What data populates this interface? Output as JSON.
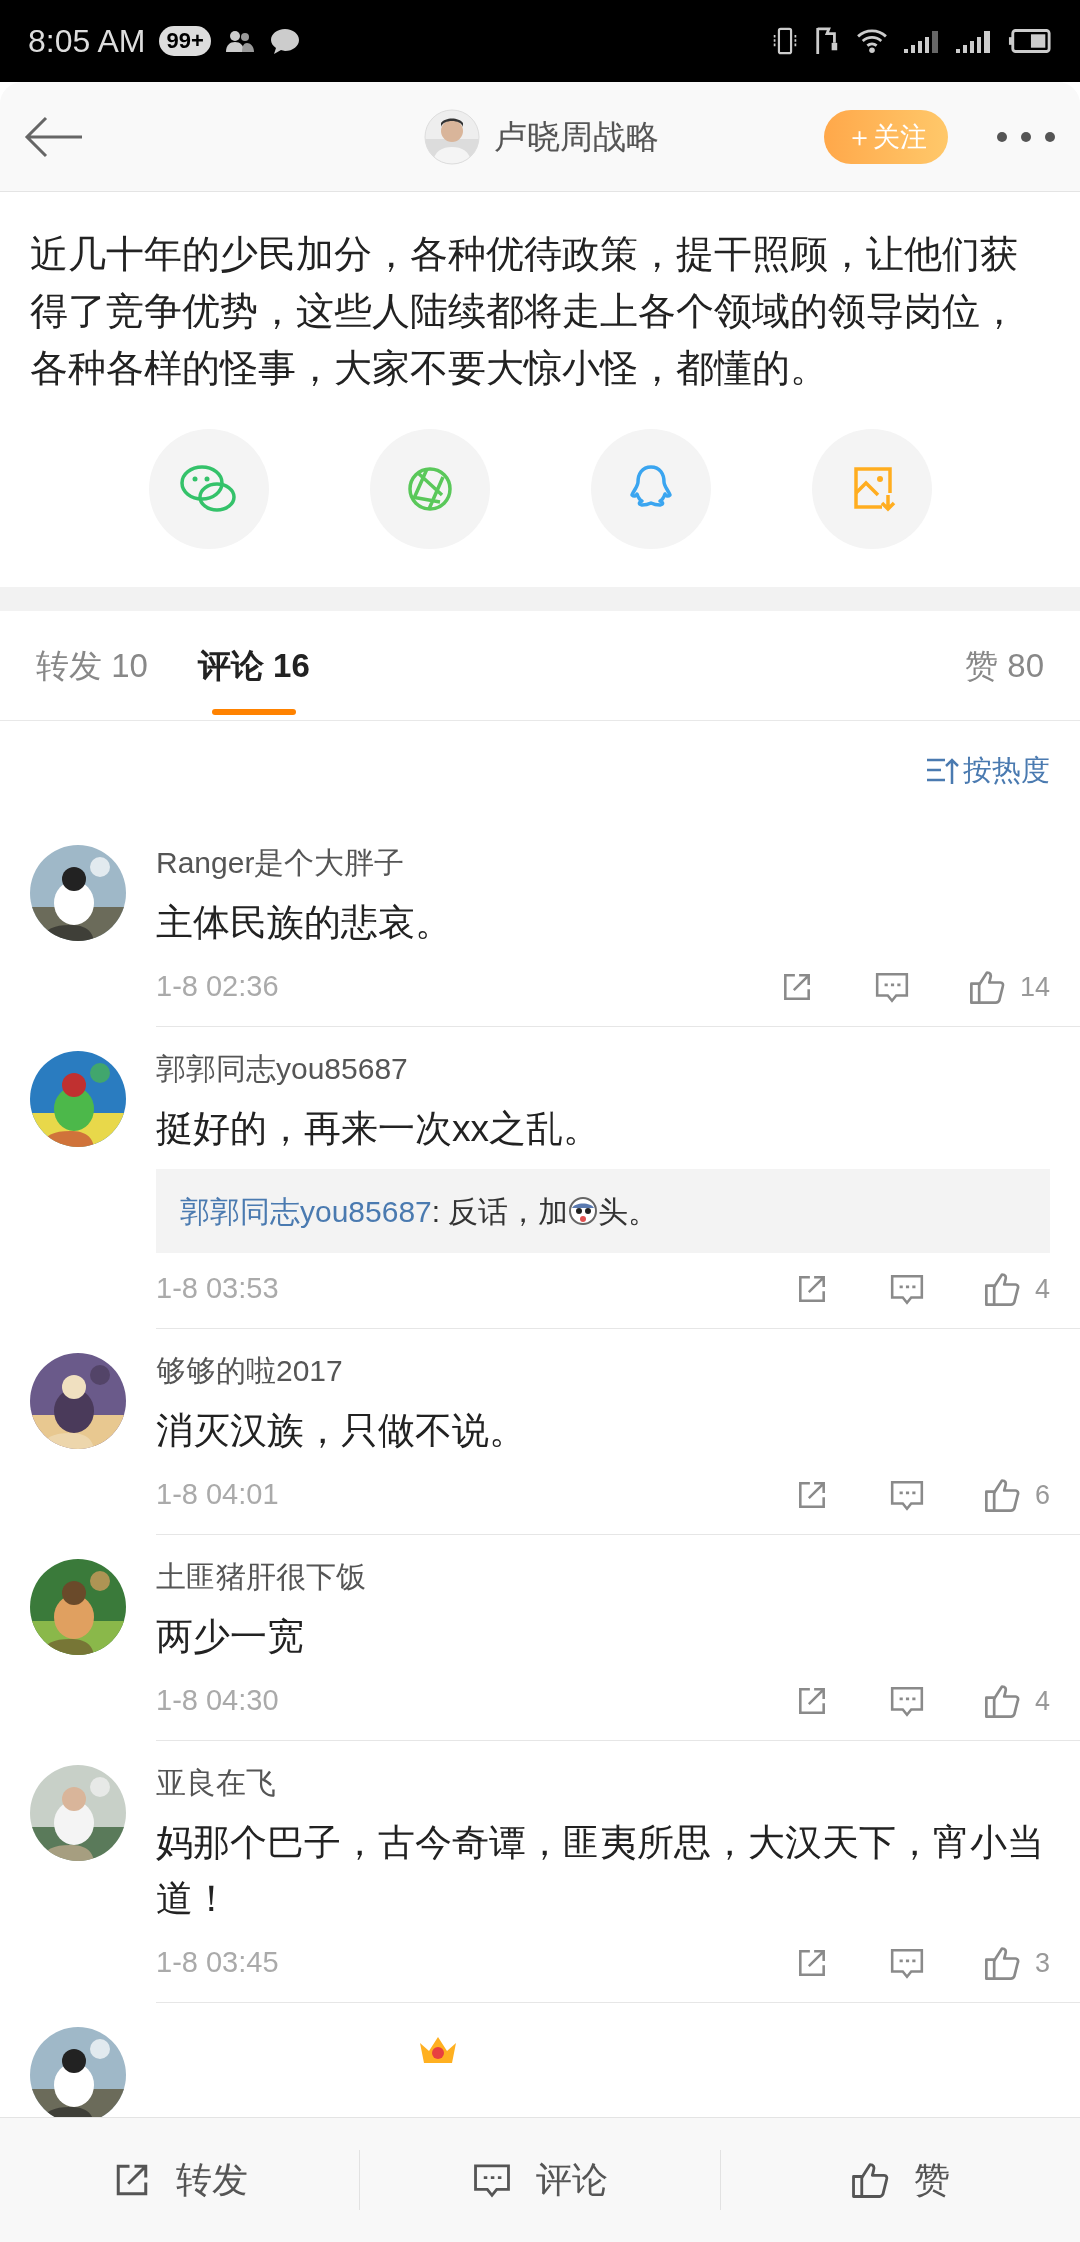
{
  "status_bar": {
    "time": "8:05 AM",
    "badge": "99+"
  },
  "header": {
    "title": "卢晓周战略",
    "follow_button": "＋关注"
  },
  "post": {
    "text": "近几十年的少民加分，各种优待政策，提干照顾，让他们获得了竞争优势，这些人陆续都将走上各个领域的领导岗位，各种各样的怪事，大家不要大惊小怪，都懂的。"
  },
  "tabs": [
    {
      "label": "转发",
      "count": "10",
      "selected": false
    },
    {
      "label": "评论",
      "count": "16",
      "selected": true
    },
    {
      "label": "赞",
      "count": "80",
      "selected": false
    }
  ],
  "sort": {
    "label": "按热度"
  },
  "comments": [
    {
      "name": "Ranger是个大胖子",
      "text": "主体民族的悲哀。",
      "time": "1-8 02:36",
      "likes": "14"
    },
    {
      "name": "郭郭同志you85687",
      "text": "挺好的，再来一次xx之乱。",
      "reply": {
        "author": "郭郭同志you85687",
        "text_before": ": 反话，加",
        "text_after": "头。"
      },
      "time": "1-8 03:53",
      "likes": "4"
    },
    {
      "name": "够够的啦2017",
      "text": "消灭汉族，只做不说。",
      "time": "1-8 04:01",
      "likes": "6"
    },
    {
      "name": "土匪猪肝很下饭",
      "text": "两少一宽",
      "time": "1-8 04:30",
      "likes": "4"
    },
    {
      "name": "亚良在飞",
      "text": "妈那个巴子，古今奇谭，匪夷所思，大汉天下，宵小当道！",
      "time": "1-8 03:45",
      "likes": "3"
    }
  ],
  "bottom_bar": [
    {
      "kind": "repost",
      "label": "转发"
    },
    {
      "kind": "comment",
      "label": "评论"
    },
    {
      "kind": "like",
      "label": "赞"
    }
  ]
}
